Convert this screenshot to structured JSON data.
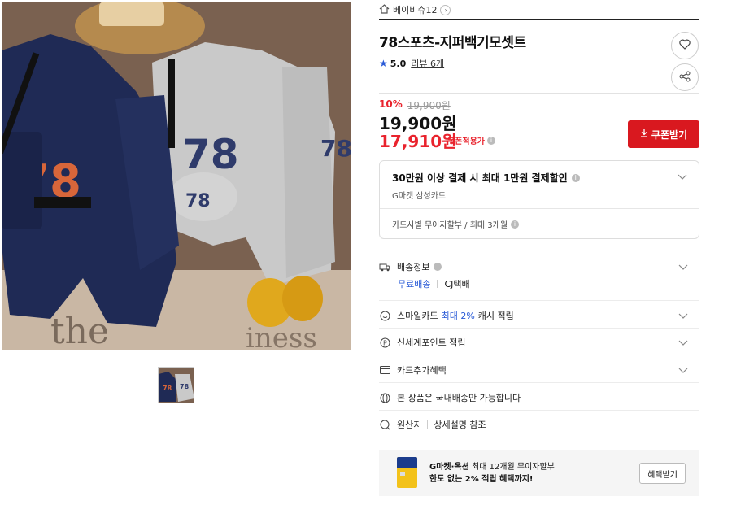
{
  "product_image": {
    "alt_icon": "product-photo"
  },
  "store": {
    "name": "베이비슈12"
  },
  "product": {
    "title": "78스포츠-지퍼백기모셋트",
    "rating": "5.0",
    "review_label": "리뷰 6개"
  },
  "pricing": {
    "discount": "10%",
    "original_price": "19,900원",
    "price": "19,900원",
    "coupon_price": "17,910원",
    "coupon_label": "쿠폰적용가",
    "coupon_button": "쿠폰받기"
  },
  "promo": {
    "title": "30만원 이상 결제 시 최대 1만원 결제할인",
    "subtitle": "G마켓 삼성카드",
    "installment": "카드사별 무이자할부 / 최대 3개월"
  },
  "shipping": {
    "label": "배송정보",
    "free": "무료배송",
    "carrier": "CJ택배"
  },
  "rows": {
    "smile_prefix": "스마일카드",
    "smile_highlight": "최대 2%",
    "smile_suffix": "캐시 적립",
    "shinsegae": "신세계포인트 적립",
    "card_benefit": "카드추가혜택",
    "domestic": "본 상품은 국내배송만 가능합니다",
    "origin_label": "원산지",
    "origin_value": "상세설명 참조"
  },
  "banner": {
    "line1_bold": "G마켓·옥션",
    "line1_rest": "최대 12개월 무이자할부",
    "line2": "한도 없는 2% 적립 혜택까지!",
    "button": "혜택받기"
  },
  "colors": {
    "accent_red": "#e9232d",
    "coupon_button": "#d9181f",
    "link_blue": "#2a5bd7"
  }
}
